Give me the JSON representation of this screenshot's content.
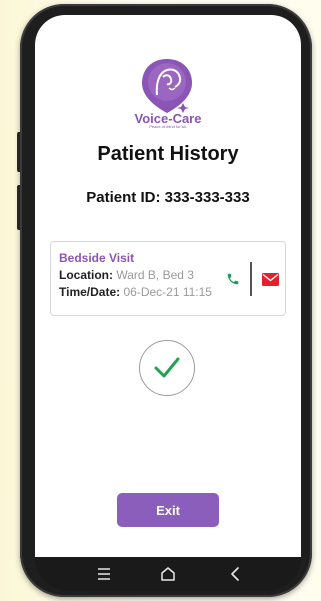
{
  "app": {
    "brand": "Voice-Care",
    "tagline": "Peace of mind for all."
  },
  "page": {
    "title": "Patient History",
    "patient_id": "Patient ID: 333-333-333"
  },
  "visit_card": {
    "title": "Bedside Visit",
    "location_label": "Location:",
    "location_value": "Ward B, Bed 3",
    "time_label": "Time/Date:",
    "time_value": "06-Dec-21 11:15"
  },
  "actions": {
    "exit_label": "Exit"
  },
  "icons": {
    "call": "phone-icon",
    "message": "mail-icon",
    "status": "checkmark-icon",
    "nav": [
      "menu-icon",
      "home-icon",
      "back-icon"
    ]
  },
  "colors": {
    "brand": "#8b55b5",
    "button": "#8b5ebb",
    "call": "#1f9d57",
    "message": "#e3202e",
    "check": "#24a154"
  }
}
